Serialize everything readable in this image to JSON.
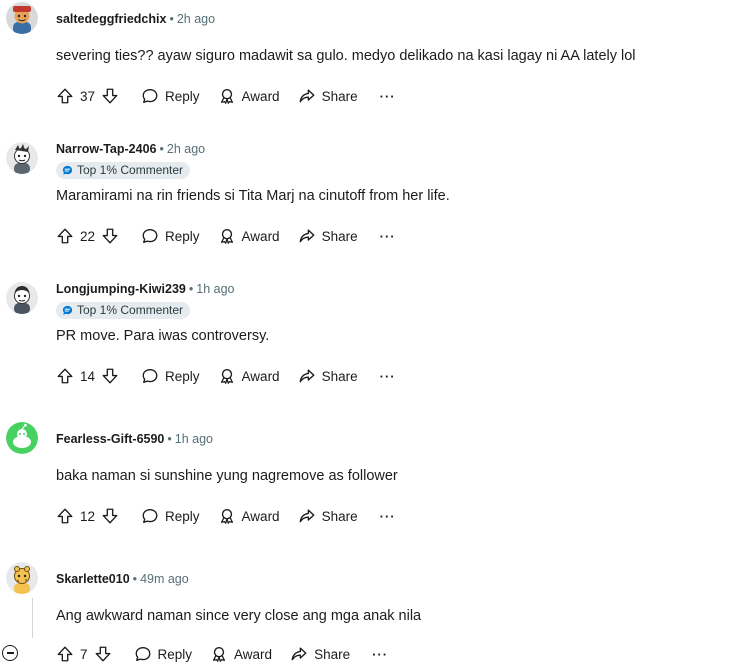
{
  "comments": [
    {
      "author": "saltedeggfriedchix",
      "time": "2h ago",
      "badge": "",
      "body": "severing ties?? ayaw siguro madawit sa gulo. medyo delikado na kasi lagay ni AA lately lol",
      "votes": "37"
    },
    {
      "author": "Narrow-Tap-2406",
      "time": "2h ago",
      "badge": "Top 1% Commenter",
      "body": "Maramirami na rin friends si Tita Marj na cinutoff from her life.",
      "votes": "22"
    },
    {
      "author": "Longjumping-Kiwi239",
      "time": "1h ago",
      "badge": "Top 1% Commenter",
      "body": "PR move. Para iwas controversy.",
      "votes": "14"
    },
    {
      "author": "Fearless-Gift-6590",
      "time": "1h ago",
      "badge": "",
      "body": "baka naman si sunshine yung nagremove as follower",
      "votes": "12"
    },
    {
      "author": "Skarlette010",
      "time": "49m ago",
      "badge": "",
      "body": "Ang awkward naman since very close ang mga anak nila",
      "votes": "7"
    }
  ],
  "labels": {
    "separator": "•",
    "reply": "Reply",
    "award": "Award",
    "share": "Share",
    "more": "···"
  },
  "colors": {
    "meta_gray": "#576f76",
    "badge_bg": "#e5ebee",
    "badge_icon": "#0079d3",
    "avatar_green": "#46d160"
  },
  "icons": [
    "upvote-icon",
    "downvote-icon",
    "reply-icon",
    "award-icon",
    "share-icon",
    "more-icon",
    "collapse-icon",
    "commenter-badge-icon"
  ]
}
